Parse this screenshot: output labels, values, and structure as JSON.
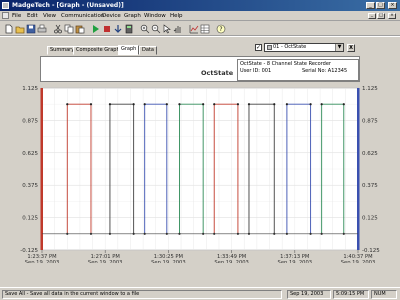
{
  "window": {
    "title": "MadgeTech - [Graph - (Unsaved)]",
    "title_bar_color": "#0a246a",
    "min_label": "_",
    "max_label": "□",
    "close_label": "×"
  },
  "menu": {
    "items": [
      "File",
      "Edit",
      "View",
      "Communication",
      "Device",
      "Graph",
      "Window",
      "Help"
    ]
  },
  "toolbar": {
    "buttons": [
      "new-icon",
      "open-icon",
      "save-icon",
      "print-icon",
      "cut-icon",
      "copy-icon",
      "paste-icon",
      "start-icon",
      "stop-icon",
      "download-icon",
      "device-icon",
      "zoom-in-icon",
      "zoom-out-icon",
      "cursor-icon",
      "hand-icon",
      "chart-icon",
      "table-icon",
      "help-icon"
    ]
  },
  "tabs": [
    {
      "label": "Summary",
      "active": false
    },
    {
      "label": "Composite Graph",
      "active": false
    },
    {
      "label": "Graph",
      "active": true
    },
    {
      "label": "Data",
      "active": false
    }
  ],
  "channel": {
    "checked": "✓",
    "selected": "01 - OctState",
    "dropdown_icon": "▼",
    "close_label": "X"
  },
  "graph": {
    "title": "OctState",
    "info": {
      "device": "OctState - 8 Channel State Recorder",
      "user_id": "User ID: 001",
      "serial": "Serial No: A12345"
    }
  },
  "chart_data": {
    "type": "line",
    "title": "OctState",
    "yticks": [
      "1.125",
      "0.875",
      "0.625",
      "0.375",
      "0.125",
      "-0.125"
    ],
    "ylim": [
      -0.125,
      1.125
    ],
    "xticks": [
      {
        "time": "1:23:37 PM",
        "date": "Sep 19, 2003"
      },
      {
        "time": "1:27:01 PM",
        "date": "Sep 19, 2003"
      },
      {
        "time": "1:30:25 PM",
        "date": "Sep 19, 2003"
      },
      {
        "time": "1:33:49 PM",
        "date": "Sep 19, 2003"
      },
      {
        "time": "1:37:13 PM",
        "date": "Sep 19, 2003"
      },
      {
        "time": "1:40:37 PM",
        "date": "Sep 19, 2003"
      }
    ],
    "high": 1.0,
    "low": 0.0,
    "pulses": [
      {
        "color": "#c0392b",
        "start": 0.08,
        "end": 0.155
      },
      {
        "color": "#404040",
        "start": 0.215,
        "end": 0.29
      },
      {
        "color": "#3a50b0",
        "start": 0.325,
        "end": 0.395
      },
      {
        "color": "#2e8b57",
        "start": 0.435,
        "end": 0.51
      },
      {
        "color": "#c0392b",
        "start": 0.545,
        "end": 0.62
      },
      {
        "color": "#404040",
        "start": 0.655,
        "end": 0.735
      },
      {
        "color": "#3a50b0",
        "start": 0.775,
        "end": 0.85
      },
      {
        "color": "#2e8b57",
        "start": 0.885,
        "end": 0.955
      }
    ],
    "left_marker_color": "#c0392b",
    "right_marker_color": "#3a50b0",
    "grid": true
  },
  "status": {
    "message": "Save All - Save all data in the current window to a file",
    "date": "Sep 19, 2003",
    "time": "5:09:15 PM",
    "mode": "NUM"
  }
}
